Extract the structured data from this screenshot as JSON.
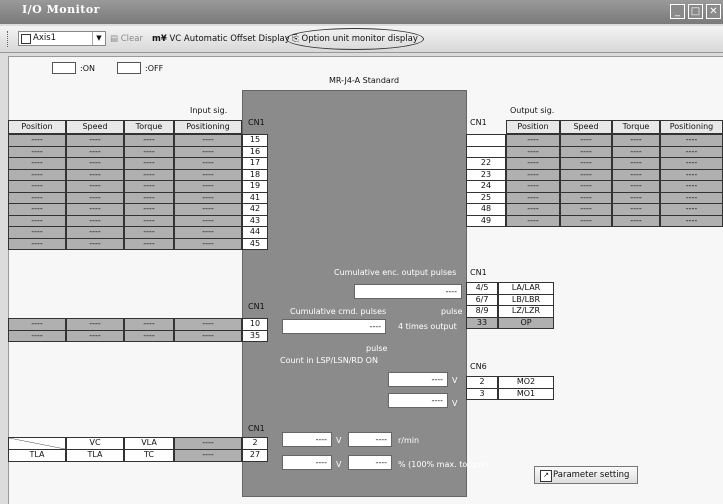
{
  "window": {
    "title": "I/O Monitor",
    "buttons": [
      "_",
      "□",
      "✕"
    ]
  },
  "toolbar": {
    "axis_select": "Axis1",
    "clear_label": "Clear",
    "vc_offset_label": "VC Automatic Offset Display",
    "option_monitor_label": "Option unit monitor display"
  },
  "legend": {
    "on": ":ON",
    "off": ":OFF"
  },
  "model": "MR-J4-A Standard",
  "input": {
    "title": "Input sig.",
    "headers": [
      "Position",
      "Speed",
      "Torque",
      "Positioning"
    ],
    "rows": [
      [
        "----",
        "----",
        "----",
        "----"
      ],
      [
        "----",
        "----",
        "----",
        "----"
      ],
      [
        "----",
        "----",
        "----",
        "----"
      ],
      [
        "----",
        "----",
        "----",
        "----"
      ],
      [
        "----",
        "----",
        "----",
        "----"
      ],
      [
        "----",
        "----",
        "----",
        "----"
      ],
      [
        "----",
        "----",
        "----",
        "----"
      ],
      [
        "----",
        "----",
        "----",
        "----"
      ],
      [
        "----",
        "----",
        "----",
        "----"
      ],
      [
        "----",
        "----",
        "----",
        "----"
      ]
    ],
    "pins_header": "CN1",
    "pins": [
      "15",
      "16",
      "17",
      "18",
      "19",
      "41",
      "42",
      "43",
      "44",
      "45"
    ],
    "rows2": [
      [
        "----",
        "----",
        "----",
        "----"
      ],
      [
        "----",
        "----",
        "----",
        "----"
      ]
    ],
    "pins2_header": "CN1",
    "pins2": [
      "10",
      "35"
    ],
    "analog": {
      "pins_header": "CN1",
      "row1": [
        "",
        "VC",
        "VLA",
        "----"
      ],
      "row2": [
        "TLA",
        "TLA",
        "TC",
        "----"
      ],
      "pins": [
        "2",
        "27"
      ]
    }
  },
  "output": {
    "title": "Output sig.",
    "headers": [
      "Position",
      "Speed",
      "Torque",
      "Positioning"
    ],
    "pins_header": "CN1",
    "pins": [
      "",
      "",
      "22",
      "23",
      "24",
      "25",
      "48",
      "49"
    ],
    "rows": [
      [
        "----",
        "----",
        "----",
        "----"
      ],
      [
        "----",
        "----",
        "----",
        "----"
      ],
      [
        "----",
        "----",
        "----",
        "----"
      ],
      [
        "----",
        "----",
        "----",
        "----"
      ],
      [
        "----",
        "----",
        "----",
        "----"
      ],
      [
        "----",
        "----",
        "----",
        "----"
      ],
      [
        "----",
        "----",
        "----",
        "----"
      ],
      [
        "----",
        "----",
        "----",
        "----"
      ]
    ],
    "encoder_header": "CN1",
    "encoder": [
      {
        "pin": "4/5",
        "sig": "LA/LAR"
      },
      {
        "pin": "6/7",
        "sig": "LB/LBR"
      },
      {
        "pin": "8/9",
        "sig": "LZ/LZR"
      },
      {
        "pin": "33",
        "sig": "OP"
      }
    ],
    "cn6_header": "CN6",
    "cn6": [
      {
        "pin": "2",
        "sig": "MO2"
      },
      {
        "pin": "3",
        "sig": "MO1"
      }
    ]
  },
  "monitor": {
    "cum_enc_label": "Cumulative enc. output pulses",
    "cum_enc_value": "----",
    "cum_enc_unit": "pulse",
    "times_output": "4 times output",
    "cum_cmd_label": "Cumulative cmd. pulses",
    "cum_cmd_value": "----",
    "cum_cmd_unit": "pulse",
    "count_label": "Count in LSP/LSN/RD ON",
    "mo2_value": "----",
    "mo1_value": "----",
    "mo_unit": "V",
    "analog_v1": "----",
    "analog_v2": "----",
    "analog_v_unit": "V",
    "speed_value": "----",
    "speed_unit": "r/min",
    "torque_value": "----",
    "torque_unit": "% (100% max. torque)"
  },
  "parameter_button": "Parameter setting"
}
